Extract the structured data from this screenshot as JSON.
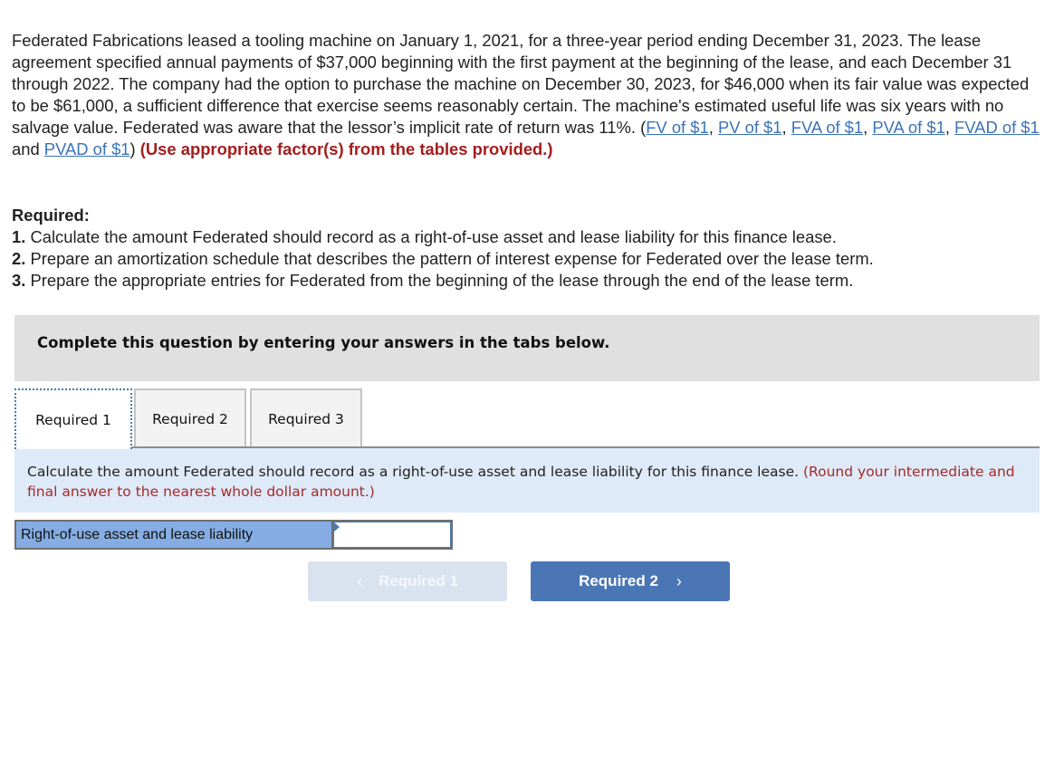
{
  "problem": {
    "text_before_links": "Federated Fabrications leased a tooling machine on January 1, 2021, for a three-year period ending December 31, 2023. The lease agreement specified annual payments of $37,000 beginning with the first payment at the beginning of the lease, and each December 31 through 2022. The company had the option to purchase the machine on December 30, 2023, for $46,000 when its fair value was expected to be $61,000, a sufficient difference that exercise seems reasonably certain. The machine's estimated useful life was six years with no salvage value. Federated was aware that the lessor’s implicit rate of return was 11%. (",
    "links": [
      "FV of $1",
      "PV of $1",
      "FVA of $1",
      "PVA of $1",
      "FVAD of $1",
      "PVAD of $1"
    ],
    "separator": ", ",
    "and_text": " and ",
    "close_paren": ")",
    "instruction": " (Use appropriate factor(s) from the tables provided.)"
  },
  "required": {
    "heading": "Required:",
    "items": [
      {
        "num": "1.",
        "text": " Calculate the amount Federated should record as a right-of-use asset and lease liability for this finance lease."
      },
      {
        "num": "2.",
        "text": " Prepare an amortization schedule that describes the pattern of interest expense for Federated over the lease term."
      },
      {
        "num": "3.",
        "text": " Prepare the appropriate entries for Federated from the beginning of the lease through the end of the lease term."
      }
    ]
  },
  "banner": "Complete this question by entering your answers in the tabs below.",
  "tabs": [
    {
      "label": "Required 1",
      "active": true
    },
    {
      "label": "Required 2",
      "active": false
    },
    {
      "label": "Required 3",
      "active": false
    }
  ],
  "instructions": {
    "text": "Calculate the amount Federated should record as a right-of-use asset and lease liability for this finance lease. ",
    "note": "(Round your intermediate and final answer to the nearest whole dollar amount.)"
  },
  "answer": {
    "label": "Right-of-use asset and lease liability",
    "value": ""
  },
  "navigation": {
    "prev_label": "Required 1",
    "prev_icon": "‹",
    "next_label": "Required 2",
    "next_icon": "›"
  }
}
